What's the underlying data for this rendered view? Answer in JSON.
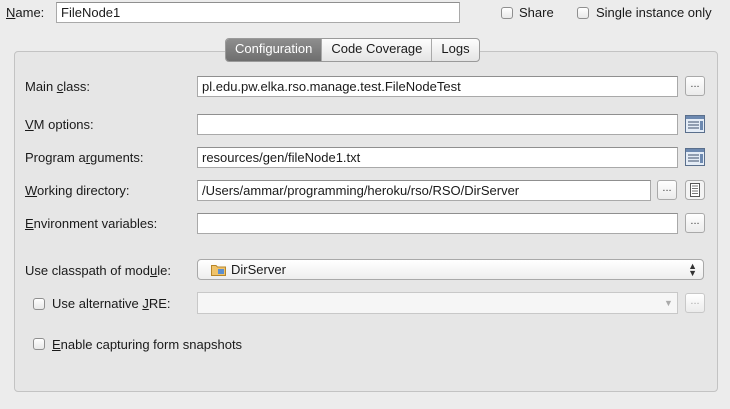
{
  "header": {
    "name_label_prefix": "",
    "name_label_mnemonic": "N",
    "name_label_rest": "ame:",
    "name_value": "FileNode1",
    "share_label": "Share",
    "single_instance_label": "Single instance only"
  },
  "tabs": [
    {
      "label": "Configuration",
      "active": true
    },
    {
      "label": "Code Coverage",
      "active": false
    },
    {
      "label": "Logs",
      "active": false
    }
  ],
  "form": {
    "main_class": {
      "pre": "Main ",
      "mn": "c",
      "post": "lass:",
      "value": "pl.edu.pw.elka.rso.manage.test.FileNodeTest"
    },
    "vm_options": {
      "pre": "",
      "mn": "V",
      "post": "M options:",
      "value": ""
    },
    "program_arguments": {
      "pre": "Program a",
      "mn": "r",
      "post": "guments:",
      "value": "resources/gen/fileNode1.txt"
    },
    "working_directory": {
      "pre": "",
      "mn": "W",
      "post": "orking directory:",
      "value": "/Users/ammar/programming/heroku/rso/RSO/DirServer"
    },
    "environment_variables": {
      "pre": "",
      "mn": "E",
      "post": "nvironment variables:",
      "value": ""
    },
    "classpath_module": {
      "pre": "Use classpath of mod",
      "mn": "u",
      "post": "le:",
      "value": "DirServer"
    },
    "alt_jre": {
      "pre": "Use alternative ",
      "mn": "J",
      "post": "RE:",
      "value": ""
    },
    "form_snapshots": {
      "pre": "",
      "mn": "E",
      "post": "nable capturing form snapshots"
    }
  },
  "icons": {
    "browse": "ellipsis-button",
    "expand": "expand-editor-icon",
    "folder": "module-folder-icon"
  },
  "colors": {
    "active_tab": "#7d7d7d",
    "background": "#ececec",
    "panel": "#e6e6e6"
  }
}
